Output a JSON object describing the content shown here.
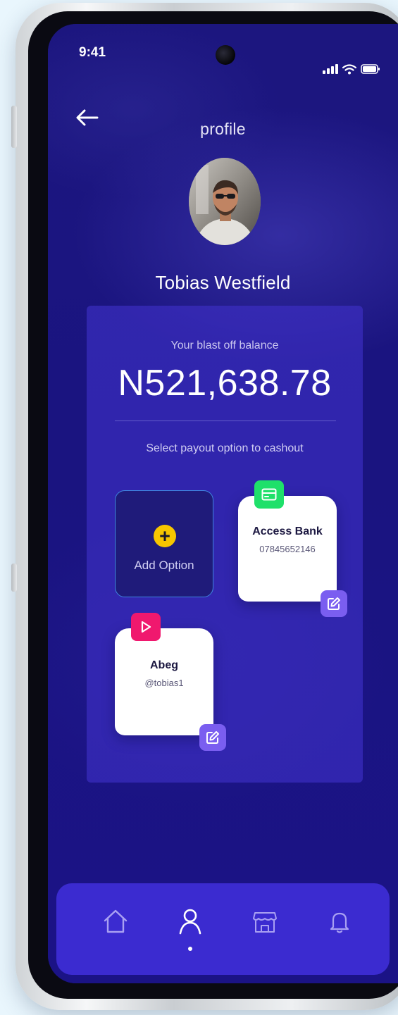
{
  "status_bar": {
    "time": "9:41",
    "icons": [
      "cellular-signal-icon",
      "wifi-icon",
      "battery-icon"
    ]
  },
  "header": {
    "back_icon": "arrow-left-icon",
    "title": "profile"
  },
  "profile": {
    "user_name": "Tobias Westfield"
  },
  "balance": {
    "label": "Your blast off balance",
    "amount": "N521,638.78",
    "payout_instruction": "Select payout option to cashout"
  },
  "payout_options": {
    "add_option": {
      "label": "Add Option",
      "icon": "plus-icon"
    },
    "items": [
      {
        "name": "Access Bank",
        "detail": "07845652146",
        "badge_icon": "card-icon",
        "badge_color": "#1fe06a"
      },
      {
        "name": "Abeg",
        "detail": "@tobias1",
        "badge_icon": "play-icon",
        "badge_color": "#f0186e"
      }
    ],
    "edit_icon": "edit-icon"
  },
  "bottom_nav": {
    "items": [
      {
        "icon": "home-icon",
        "active": false
      },
      {
        "icon": "user-icon",
        "active": true
      },
      {
        "icon": "store-icon",
        "active": false
      },
      {
        "icon": "bell-icon",
        "active": false
      }
    ]
  },
  "colors": {
    "screen_background": "#17127a",
    "card_background": "#3f30c8",
    "nav_background": "#3b2bd0",
    "add_option_plus": "#f7c600",
    "edit_button": "#7a5ef0"
  }
}
